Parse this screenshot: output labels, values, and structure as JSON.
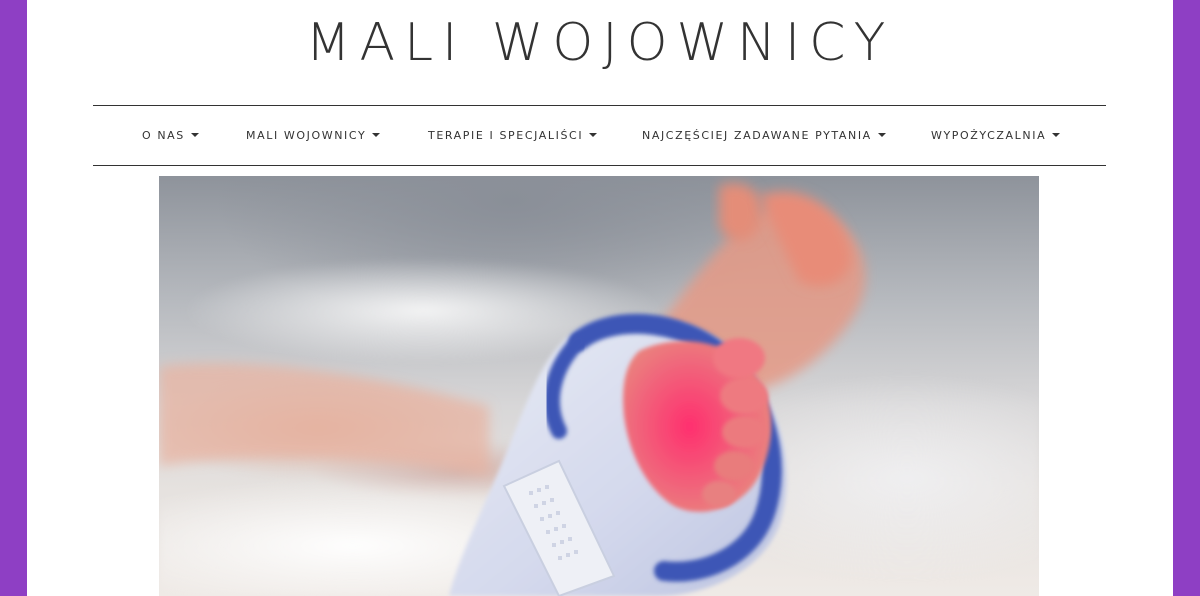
{
  "header": {
    "site_title": "MALI WOJOWNICY"
  },
  "nav": {
    "items": [
      {
        "label": "O NAS"
      },
      {
        "label": "MALI WOJOWNICY"
      },
      {
        "label": "TERAPIE I SPECJALIŚCI"
      },
      {
        "label": "NAJCZĘŚCIEJ ZADAWANE PYTANIA"
      },
      {
        "label": "WYPOŻYCZALNIA"
      }
    ]
  },
  "hero": {
    "image_subject": "premature-baby-foot-with-pulse-oximeter"
  },
  "colors": {
    "frame": "#8e3fc4",
    "background": "#ffffff",
    "text": "#222222"
  }
}
